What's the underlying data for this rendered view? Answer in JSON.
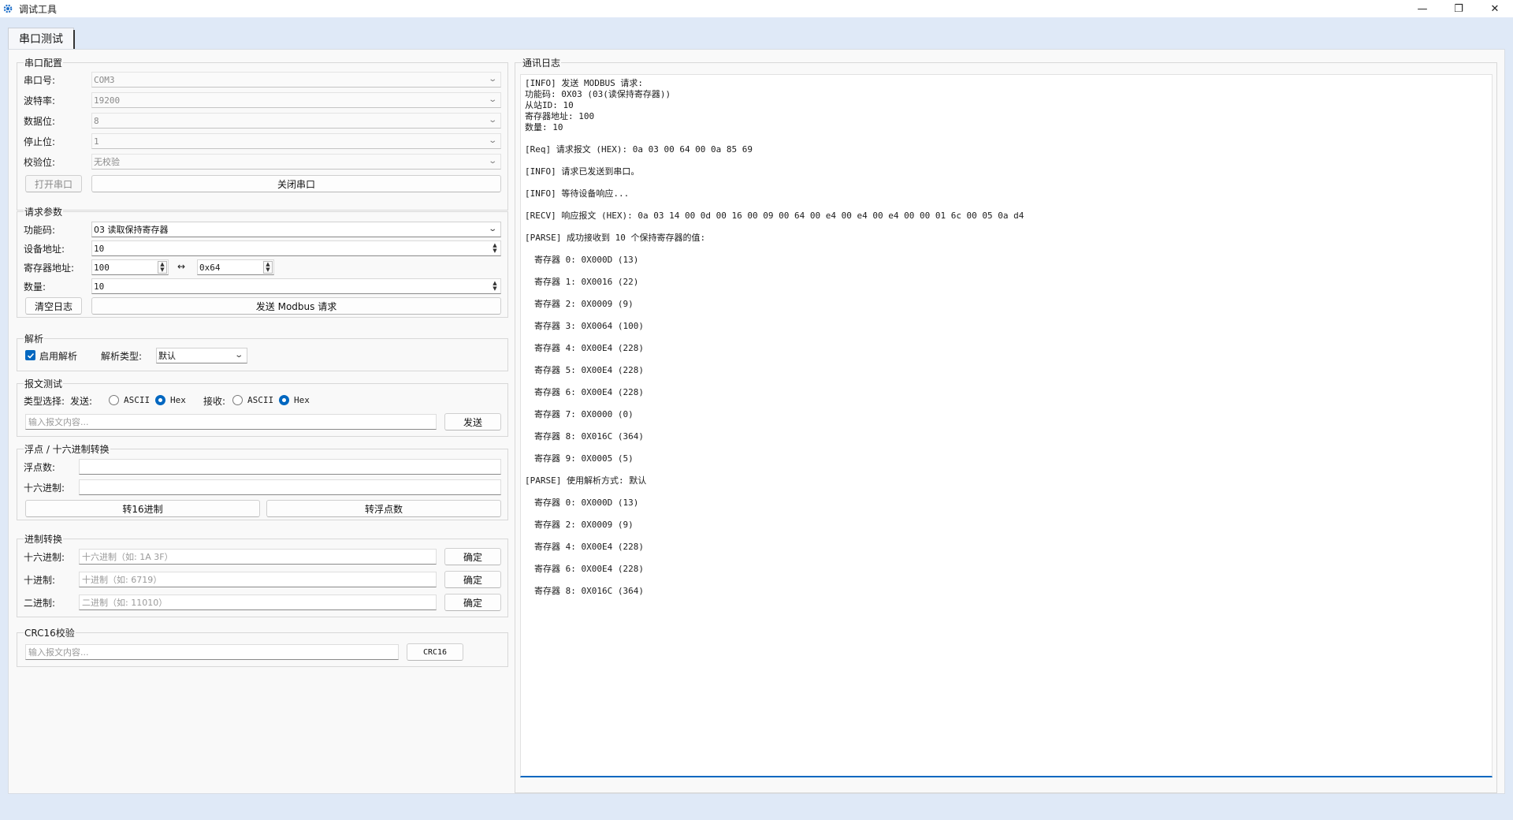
{
  "window": {
    "title": "调试工具",
    "controls": {
      "minimize": "—",
      "restore": "❐",
      "close": "✕"
    }
  },
  "tabs": [
    {
      "label": "串口测试"
    }
  ],
  "serial_config": {
    "title": "串口配置",
    "port_label": "串口号:",
    "port_value": "COM3",
    "baud_label": "波特率:",
    "baud_value": "19200",
    "databits_label": "数据位:",
    "databits_value": "8",
    "stopbits_label": "停止位:",
    "stopbits_value": "1",
    "parity_label": "校验位:",
    "parity_value": "无校验",
    "open_button": "打开串口",
    "close_button": "关闭串口"
  },
  "request_params": {
    "title": "请求参数",
    "function_label": "功能码:",
    "function_value": "03 读取保持寄存器",
    "device_label": "设备地址:",
    "device_value": "10",
    "register_label": "寄存器地址:",
    "register_dec": "100",
    "register_arrow": "↔",
    "register_hex": "0x64",
    "count_label": "数量:",
    "count_value": "10",
    "clear_log_button": "清空日志",
    "send_button": "发送 Modbus 请求"
  },
  "parse": {
    "title": "解析",
    "enable_label": "启用解析",
    "enabled": true,
    "type_label": "解析类型:",
    "type_value": "默认"
  },
  "message_test": {
    "title": "报文测试",
    "type_label": "类型选择:",
    "send_label": "发送:",
    "recv_label": "接收:",
    "ascii": "ASCII",
    "hex": "Hex",
    "send_selected": "Hex",
    "recv_selected": "Hex",
    "input_placeholder": "输入报文内容...",
    "send_button": "发送"
  },
  "float_hex": {
    "title": "浮点 / 十六进制转换",
    "float_label": "浮点数:",
    "hex_label": "十六进制:",
    "to_hex_button": "转16进制",
    "to_float_button": "转浮点数"
  },
  "base_convert": {
    "title": "进制转换",
    "hex_label": "十六进制:",
    "hex_placeholder": "十六进制（如: 1A 3F）",
    "dec_label": "十进制:",
    "dec_placeholder": "十进制（如: 6719）",
    "bin_label": "二进制:",
    "bin_placeholder": "二进制（如: 11010）",
    "confirm_button": "确定"
  },
  "crc16": {
    "title": "CRC16校验",
    "input_placeholder": "输入报文内容...",
    "button": "CRC16"
  },
  "log": {
    "title": "通讯日志",
    "lines": [
      {
        "text": "[INFO] 发送 MODBUS 请求:",
        "gap": false,
        "indent": false
      },
      {
        "text": "功能码: 0X03 (03(读保持寄存器))",
        "gap": false,
        "indent": false
      },
      {
        "text": "从站ID: 10",
        "gap": false,
        "indent": false
      },
      {
        "text": "寄存器地址: 100",
        "gap": false,
        "indent": false
      },
      {
        "text": "数量: 10",
        "gap": true,
        "indent": false
      },
      {
        "text": "[Req] 请求报文 (HEX): 0a 03 00 64 00 0a 85 69",
        "gap": true,
        "indent": false
      },
      {
        "text": "[INFO] 请求已发送到串口。",
        "gap": true,
        "indent": false
      },
      {
        "text": "[INFO] 等待设备响应...",
        "gap": true,
        "indent": false
      },
      {
        "text": "[RECV] 响应报文 (HEX): 0a 03 14 00 0d 00 16 00 09 00 64 00 e4 00 e4 00 e4 00 00 01 6c 00 05 0a d4",
        "gap": true,
        "indent": false
      },
      {
        "text": "[PARSE] 成功接收到 10 个保持寄存器的值:",
        "gap": true,
        "indent": false
      },
      {
        "text": "寄存器 0: 0X000D (13)",
        "gap": true,
        "indent": true
      },
      {
        "text": "寄存器 1: 0X0016 (22)",
        "gap": true,
        "indent": true
      },
      {
        "text": "寄存器 2: 0X0009 (9)",
        "gap": true,
        "indent": true
      },
      {
        "text": "寄存器 3: 0X0064 (100)",
        "gap": true,
        "indent": true
      },
      {
        "text": "寄存器 4: 0X00E4 (228)",
        "gap": true,
        "indent": true
      },
      {
        "text": "寄存器 5: 0X00E4 (228)",
        "gap": true,
        "indent": true
      },
      {
        "text": "寄存器 6: 0X00E4 (228)",
        "gap": true,
        "indent": true
      },
      {
        "text": "寄存器 7: 0X0000 (0)",
        "gap": true,
        "indent": true
      },
      {
        "text": "寄存器 8: 0X016C (364)",
        "gap": true,
        "indent": true
      },
      {
        "text": "寄存器 9: 0X0005 (5)",
        "gap": true,
        "indent": true
      },
      {
        "text": "[PARSE] 使用解析方式: 默认",
        "gap": true,
        "indent": false
      },
      {
        "text": "寄存器 0: 0X000D (13)",
        "gap": true,
        "indent": true
      },
      {
        "text": "寄存器 2: 0X0009 (9)",
        "gap": true,
        "indent": true
      },
      {
        "text": "寄存器 4: 0X00E4 (228)",
        "gap": true,
        "indent": true
      },
      {
        "text": "寄存器 6: 0X00E4 (228)",
        "gap": true,
        "indent": true
      },
      {
        "text": "寄存器 8: 0X016C (364)",
        "gap": false,
        "indent": true
      }
    ]
  }
}
